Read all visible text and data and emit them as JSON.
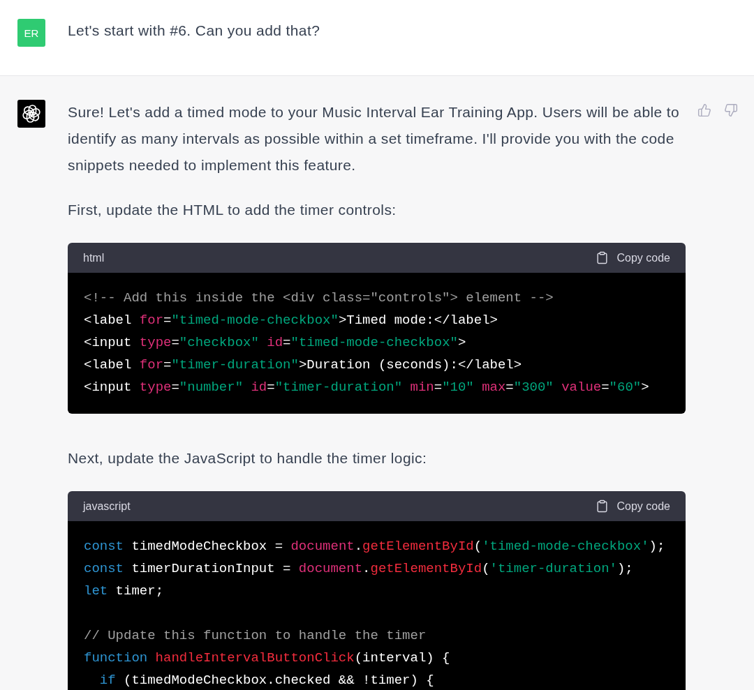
{
  "user_message": {
    "avatar_initials": "ER",
    "text": "Let's start with #6. Can you add that?"
  },
  "assistant_message": {
    "blocks": [
      {
        "kind": "paragraph",
        "text": "Sure! Let's add a timed mode to your Music Interval Ear Training App. Users will be able to identify as many intervals as possible within a set timeframe. I'll provide you with the code snippets needed to implement this feature."
      },
      {
        "kind": "paragraph",
        "text": "First, update the HTML to add the timer controls:"
      },
      {
        "kind": "code",
        "language": "html",
        "copy_label": "Copy code",
        "lines": [
          {
            "kind": "code",
            "tokens": [
              {
                "kind": "comment",
                "text": "<!-- Add this inside the <div class=\"controls\"> element -->"
              }
            ]
          },
          {
            "kind": "code",
            "tokens": [
              {
                "kind": "plain",
                "text": "<label "
              },
              {
                "kind": "attr",
                "text": "for"
              },
              {
                "kind": "plain",
                "text": "="
              },
              {
                "kind": "string",
                "text": "\"timed-mode-checkbox\""
              },
              {
                "kind": "plain",
                "text": ">Timed mode:</label>"
              }
            ]
          },
          {
            "kind": "code",
            "tokens": [
              {
                "kind": "plain",
                "text": "<input "
              },
              {
                "kind": "attr",
                "text": "type"
              },
              {
                "kind": "plain",
                "text": "="
              },
              {
                "kind": "string",
                "text": "\"checkbox\""
              },
              {
                "kind": "attr",
                "text": " id"
              },
              {
                "kind": "plain",
                "text": "="
              },
              {
                "kind": "string",
                "text": "\"timed-mode-checkbox\""
              },
              {
                "kind": "plain",
                "text": ">"
              }
            ]
          },
          {
            "kind": "code",
            "tokens": [
              {
                "kind": "plain",
                "text": "<label "
              },
              {
                "kind": "attr",
                "text": "for"
              },
              {
                "kind": "plain",
                "text": "="
              },
              {
                "kind": "string",
                "text": "\"timer-duration\""
              },
              {
                "kind": "plain",
                "text": ">Duration (seconds):</label>"
              }
            ]
          },
          {
            "kind": "code",
            "tokens": [
              {
                "kind": "plain",
                "text": "<input "
              },
              {
                "kind": "attr",
                "text": "type"
              },
              {
                "kind": "plain",
                "text": "="
              },
              {
                "kind": "string",
                "text": "\"number\""
              },
              {
                "kind": "attr",
                "text": " id"
              },
              {
                "kind": "plain",
                "text": "="
              },
              {
                "kind": "string",
                "text": "\"timer-duration\""
              },
              {
                "kind": "attr",
                "text": " min"
              },
              {
                "kind": "plain",
                "text": "="
              },
              {
                "kind": "string",
                "text": "\"10\""
              },
              {
                "kind": "attr",
                "text": " max"
              },
              {
                "kind": "plain",
                "text": "="
              },
              {
                "kind": "string",
                "text": "\"300\""
              },
              {
                "kind": "attr",
                "text": " value"
              },
              {
                "kind": "plain",
                "text": "="
              },
              {
                "kind": "string",
                "text": "\"60\""
              },
              {
                "kind": "plain",
                "text": ">"
              }
            ]
          }
        ]
      },
      {
        "kind": "paragraph",
        "text": "Next, update the JavaScript to handle the timer logic:"
      },
      {
        "kind": "code",
        "language": "javascript",
        "copy_label": "Copy code",
        "lines": [
          {
            "kind": "code",
            "tokens": [
              {
                "kind": "keyword",
                "text": "const"
              },
              {
                "kind": "plain",
                "text": " timedModeCheckbox = "
              },
              {
                "kind": "builtin",
                "text": "document"
              },
              {
                "kind": "plain",
                "text": "."
              },
              {
                "kind": "function",
                "text": "getElementById"
              },
              {
                "kind": "plain",
                "text": "("
              },
              {
                "kind": "string",
                "text": "'timed-mode-checkbox'"
              },
              {
                "kind": "plain",
                "text": ");"
              }
            ]
          },
          {
            "kind": "code",
            "tokens": [
              {
                "kind": "keyword",
                "text": "const"
              },
              {
                "kind": "plain",
                "text": " timerDurationInput = "
              },
              {
                "kind": "builtin",
                "text": "document"
              },
              {
                "kind": "plain",
                "text": "."
              },
              {
                "kind": "function",
                "text": "getElementById"
              },
              {
                "kind": "plain",
                "text": "("
              },
              {
                "kind": "string",
                "text": "'timer-duration'"
              },
              {
                "kind": "plain",
                "text": ");"
              }
            ]
          },
          {
            "kind": "code",
            "tokens": [
              {
                "kind": "keyword",
                "text": "let"
              },
              {
                "kind": "plain",
                "text": " timer;"
              }
            ]
          },
          {
            "kind": "blank"
          },
          {
            "kind": "code",
            "tokens": [
              {
                "kind": "comment",
                "text": "// Update this function to handle the timer"
              }
            ]
          },
          {
            "kind": "code",
            "tokens": [
              {
                "kind": "keyword",
                "text": "function"
              },
              {
                "kind": "function",
                "text": " handleIntervalButtonClick"
              },
              {
                "kind": "plain",
                "text": "(interval) {"
              }
            ]
          },
          {
            "kind": "code",
            "tokens": [
              {
                "kind": "keyword",
                "text": "  if"
              },
              {
                "kind": "plain",
                "text": " (timedModeCheckbox.checked && !timer) {"
              }
            ]
          }
        ]
      }
    ]
  }
}
